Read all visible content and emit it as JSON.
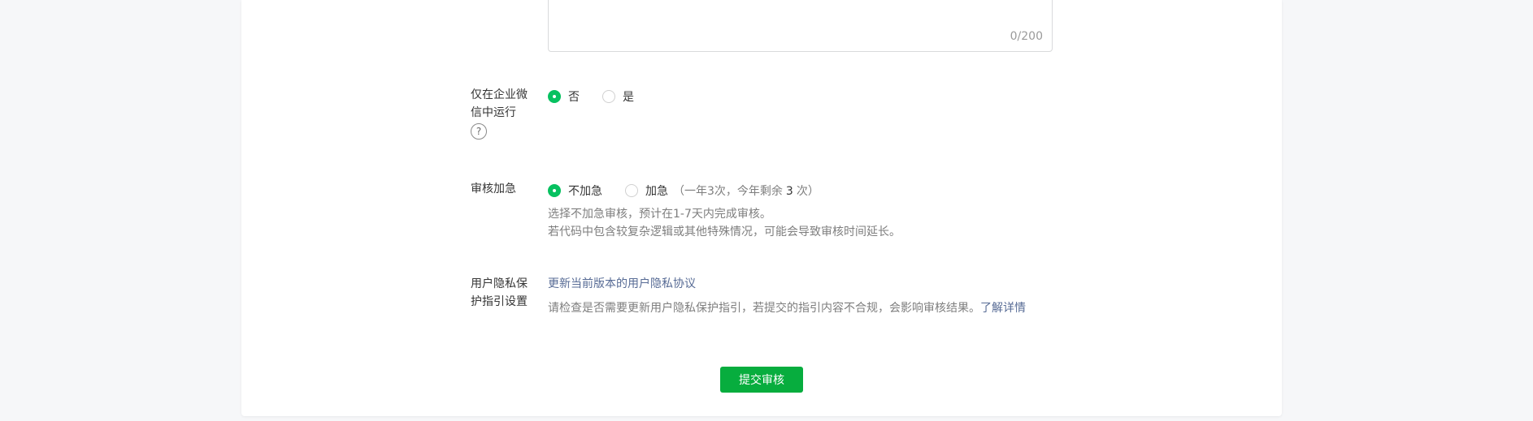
{
  "description_field": {
    "counter": "0/200"
  },
  "enterprise_only": {
    "label": "仅在企业微信中运行",
    "help_icon": "question-circle-icon",
    "help_glyph": "?",
    "options": [
      {
        "label": "否",
        "checked": true
      },
      {
        "label": "是",
        "checked": false
      }
    ]
  },
  "expedite": {
    "label": "审核加急",
    "options": [
      {
        "label": "不加急",
        "checked": true
      },
      {
        "label": "加急",
        "checked": false
      }
    ],
    "quota_prefix": "（一年3次，今年剩余",
    "quota_count": "3",
    "quota_suffix": "次）",
    "desc_line1": "选择不加急审核，预计在1-7天内完成审核。",
    "desc_line2": "若代码中包含较复杂逻辑或其他特殊情况，可能会导致审核时间延长。"
  },
  "privacy": {
    "label": "用户隐私保护指引设置",
    "update_link": "更新当前版本的用户隐私协议",
    "notice": "请检查是否需要更新用户隐私保护指引，若提交的指引内容不合规，会影响审核结果。",
    "learn_more": "了解详情"
  },
  "submit_label": "提交审核",
  "colors": {
    "primary_green": "#07ad3e",
    "radio_green": "#07c160",
    "link_blue": "#576b95"
  }
}
